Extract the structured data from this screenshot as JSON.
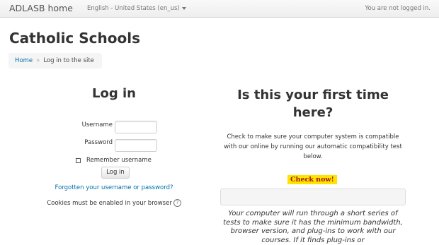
{
  "navbar": {
    "brand": "ADLASB home",
    "language": "English - United States (en_us)",
    "login_status": "You are not logged in."
  },
  "page": {
    "title": "Catholic Schools"
  },
  "breadcrumb": {
    "home": "Home",
    "separator": "»",
    "current": "Log in to the site"
  },
  "login": {
    "heading": "Log in",
    "username_label": "Username",
    "username_value": "",
    "password_label": "Password",
    "password_value": "",
    "remember_label": "Remember username",
    "button_label": "Log in",
    "forgot_link": "Forgotten your username or password?",
    "cookies_text": "Cookies must be enabled in your browser",
    "help_icon": "question-circle-icon"
  },
  "first_time": {
    "heading": "Is this your first time here?",
    "check_text": "Check to make sure your computer system is compatible with our online by running our automatic compatibility test below.",
    "check_button": "Check now!",
    "result_value": "",
    "description": "Your computer will run through a short series of tests to make sure it has the minimum bandwidth, browser version, and plug-ins to work with our courses. If it finds plug-ins or"
  },
  "colors": {
    "link": "#0070a8",
    "check_button_bg": "#ffe400",
    "check_button_text": "#a31515"
  }
}
